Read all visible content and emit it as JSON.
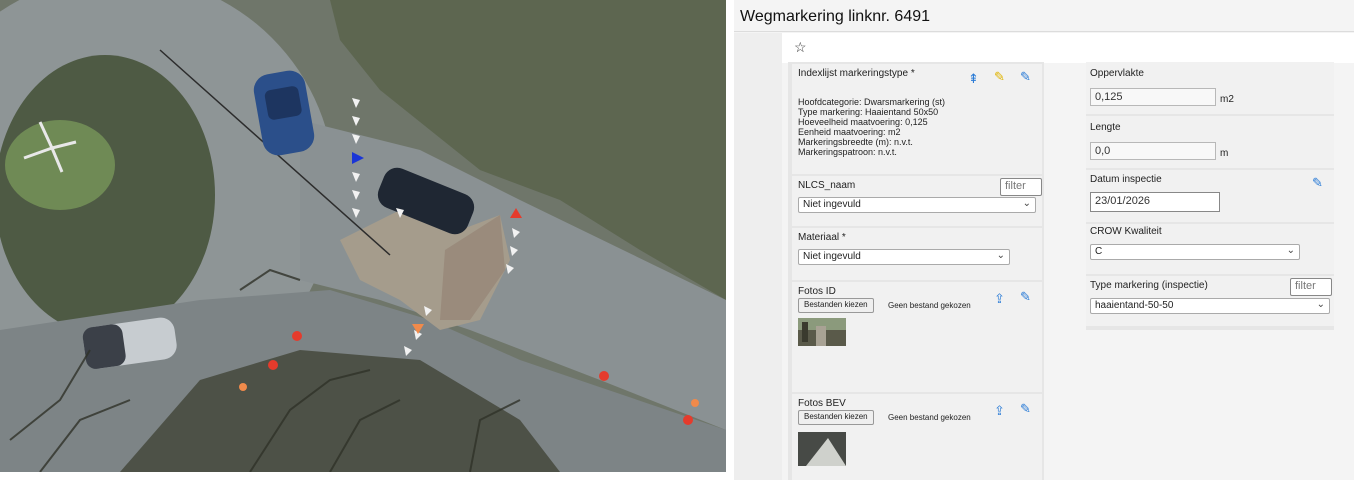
{
  "window": {
    "title": "Wegmarkering linknr. 6491"
  },
  "toolbar": {
    "favorite_icon": "star-icon"
  },
  "left_column": {
    "index": {
      "label": "Indexlijst markeringstype *",
      "details": [
        "Hoofdcategorie: Dwarsmarkering (st)",
        "Type markering: Haaientand 50x50",
        "Hoeveelheid maatvoering: 0,125",
        "Eenheid maatvoering: m2",
        "Markeringsbreedte (m): n.v.t.",
        "Markeringspatroon: n.v.t."
      ]
    },
    "nlcs": {
      "label": "NLCS_naam",
      "filter_placeholder": "filter",
      "value": "Niet ingevuld"
    },
    "materiaal": {
      "label": "Materiaal *",
      "value": "Niet ingevuld"
    },
    "fotos_id": {
      "label": "Fotos ID",
      "button": "Bestanden kiezen",
      "status": "Geen bestand gekozen"
    },
    "fotos_bev": {
      "label": "Fotos BEV",
      "button": "Bestanden kiezen",
      "status": "Geen bestand gekozen"
    }
  },
  "right_column": {
    "oppervlakte": {
      "label": "Oppervlakte",
      "value": "0,125",
      "unit": "m2"
    },
    "lengte": {
      "label": "Lengte",
      "value": "0,0",
      "unit": "m"
    },
    "datum": {
      "label": "Datum inspectie",
      "value": "23/01/2026"
    },
    "crow": {
      "label": "CROW Kwaliteit",
      "value": "C"
    },
    "type_inspectie": {
      "label": "Type markering (inspectie)",
      "filter_placeholder": "filter",
      "value": "haaientand-50-50"
    }
  },
  "colors": {
    "marker_red": "#e53b2c",
    "marker_orange": "#f08a4b",
    "marker_blue": "#1a35d6",
    "icon_blue": "#2a7bd6"
  }
}
